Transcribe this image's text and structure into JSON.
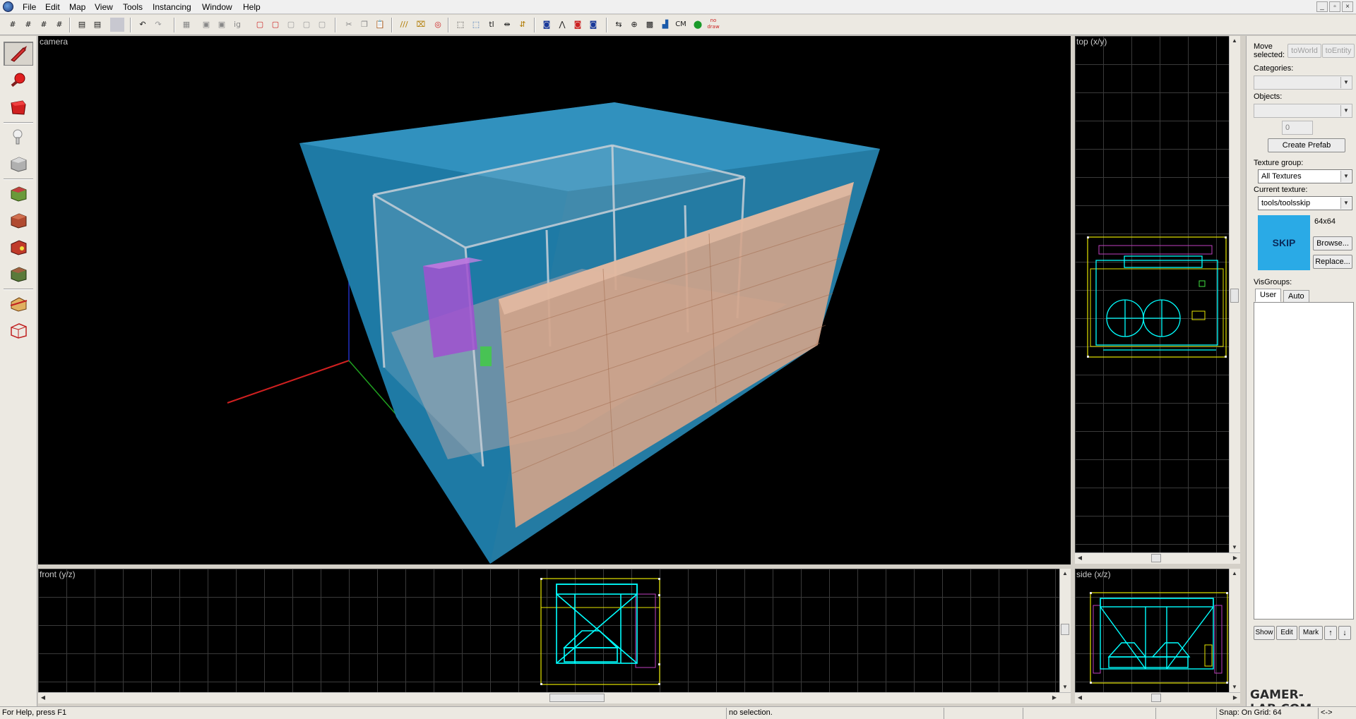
{
  "menu": {
    "items": [
      "File",
      "Edit",
      "Map",
      "View",
      "Tools",
      "Instancing",
      "Window",
      "Help"
    ]
  },
  "window_controls": {
    "minimize": "_",
    "restore": "▫",
    "close": "×"
  },
  "toolbar": {
    "cm_label": "CM",
    "nodraw_label": "no draw"
  },
  "viewports": {
    "camera": {
      "label": "camera"
    },
    "top": {
      "label": "top (x/y)"
    },
    "front": {
      "label": "front (y/z)"
    },
    "side": {
      "label": "side (x/z)"
    }
  },
  "right_panel": {
    "move_selected_label": "Move selected:",
    "to_world": "toWorld",
    "to_entity": "toEntity",
    "categories_label": "Categories:",
    "objects_label": "Objects:",
    "count_value": "0",
    "create_prefab": "Create Prefab",
    "texture_group_label": "Texture group:",
    "texture_group_value": "All Textures",
    "current_texture_label": "Current texture:",
    "current_texture_value": "tools/toolsskip",
    "texture_size": "64x64",
    "texture_preview_text": "SKIP",
    "browse": "Browse...",
    "replace": "Replace...",
    "visgroups_label": "VisGroups:",
    "tab_user": "User",
    "tab_auto": "Auto",
    "show": "Show",
    "edit": "Edit",
    "mark": "Mark",
    "up_arrow": "↑",
    "down_arrow": "↓"
  },
  "status": {
    "help": "For Help, press F1",
    "selection": "no selection.",
    "snap": "Snap: On Grid: 64",
    "arrows": "<->"
  },
  "watermark": "GAMER-LAB.COM",
  "colors": {
    "camera_bg": "#000000",
    "skip_blue": "#2aaae6",
    "wire_cyan": "#00ffff",
    "wire_yellow": "#e6e600",
    "wire_magenta": "#c040c0"
  }
}
